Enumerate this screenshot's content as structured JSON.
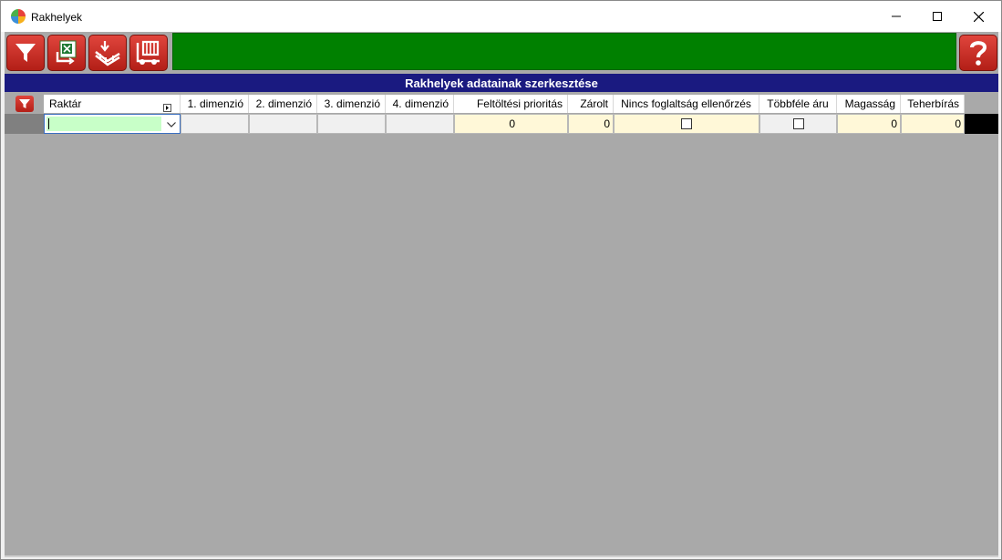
{
  "window": {
    "title": "Rakhelyek"
  },
  "toolbar": {
    "buttons": [
      {
        "name": "filter-button",
        "icon": "filter-icon"
      },
      {
        "name": "excel-export-button",
        "icon": "excel-icon"
      },
      {
        "name": "pallet-in-button",
        "icon": "pallet-icon"
      },
      {
        "name": "forklift-button",
        "icon": "forklift-icon"
      }
    ],
    "help_icon": "question-mark-icon",
    "status_color": "#008000"
  },
  "form": {
    "header": "Rakhelyek adatainak szerkesztése"
  },
  "grid": {
    "columns": [
      {
        "key": "raktar",
        "label": "Raktár"
      },
      {
        "key": "dim1",
        "label": "1. dimenzió"
      },
      {
        "key": "dim2",
        "label": "2. dimenzió"
      },
      {
        "key": "dim3",
        "label": "3. dimenzió"
      },
      {
        "key": "dim4",
        "label": "4. dimenzió"
      },
      {
        "key": "prioritas",
        "label": "Feltöltési prioritás"
      },
      {
        "key": "zarolt",
        "label": "Zárolt"
      },
      {
        "key": "nincs",
        "label": "Nincs foglaltság ellenőrzés"
      },
      {
        "key": "tobbfele",
        "label": "Többféle áru"
      },
      {
        "key": "magassag",
        "label": "Magasság"
      },
      {
        "key": "teherbiras",
        "label": "Teherbírás"
      }
    ],
    "new_row": {
      "raktar": "",
      "dim1": "",
      "dim2": "",
      "dim3": "",
      "dim4": "",
      "prioritas": "0",
      "zarolt": "0",
      "nincs": false,
      "tobbfele": false,
      "magassag": "0",
      "teherbiras": "0"
    }
  },
  "colors": {
    "header_bar": "#1a1a80",
    "grid_background": "#a9a9a9",
    "numeric_cell": "#fff8d8",
    "active_input": "#c8ffc8"
  }
}
